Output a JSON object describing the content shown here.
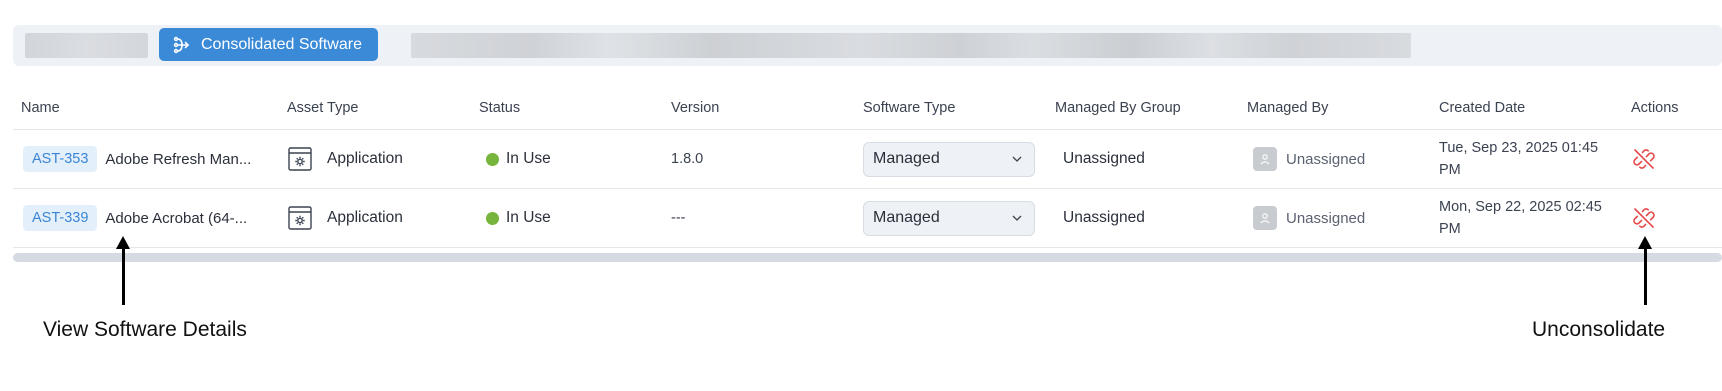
{
  "toolbar": {
    "active_tab_label": "Consolidated Software"
  },
  "table": {
    "headers": {
      "name": "Name",
      "asset_type": "Asset Type",
      "status": "Status",
      "version": "Version",
      "software_type": "Software Type",
      "managed_by_group": "Managed By Group",
      "managed_by": "Managed By",
      "created_date": "Created Date",
      "actions": "Actions"
    },
    "rows": [
      {
        "asset_id": "AST-353",
        "name": "Adobe Refresh Man...",
        "asset_type": "Application",
        "status": "In Use",
        "version": "1.8.0",
        "software_type": "Managed",
        "managed_by_group": "Unassigned",
        "managed_by": "Unassigned",
        "created_date": "Tue, Sep 23, 2025 01:45 PM"
      },
      {
        "asset_id": "AST-339",
        "name": "Adobe Acrobat (64-...",
        "asset_type": "Application",
        "status": "In Use",
        "version": "---",
        "software_type": "Managed",
        "managed_by_group": "Unassigned",
        "managed_by": "Unassigned",
        "created_date": "Mon, Sep 22, 2025 02:45 PM"
      }
    ]
  },
  "annotations": {
    "left": "View Software Details",
    "right": "Unconsolidate"
  },
  "colors": {
    "accent": "#3a8ad8",
    "status_in_use": "#76b43c",
    "unconsolidate": "#e54848"
  }
}
